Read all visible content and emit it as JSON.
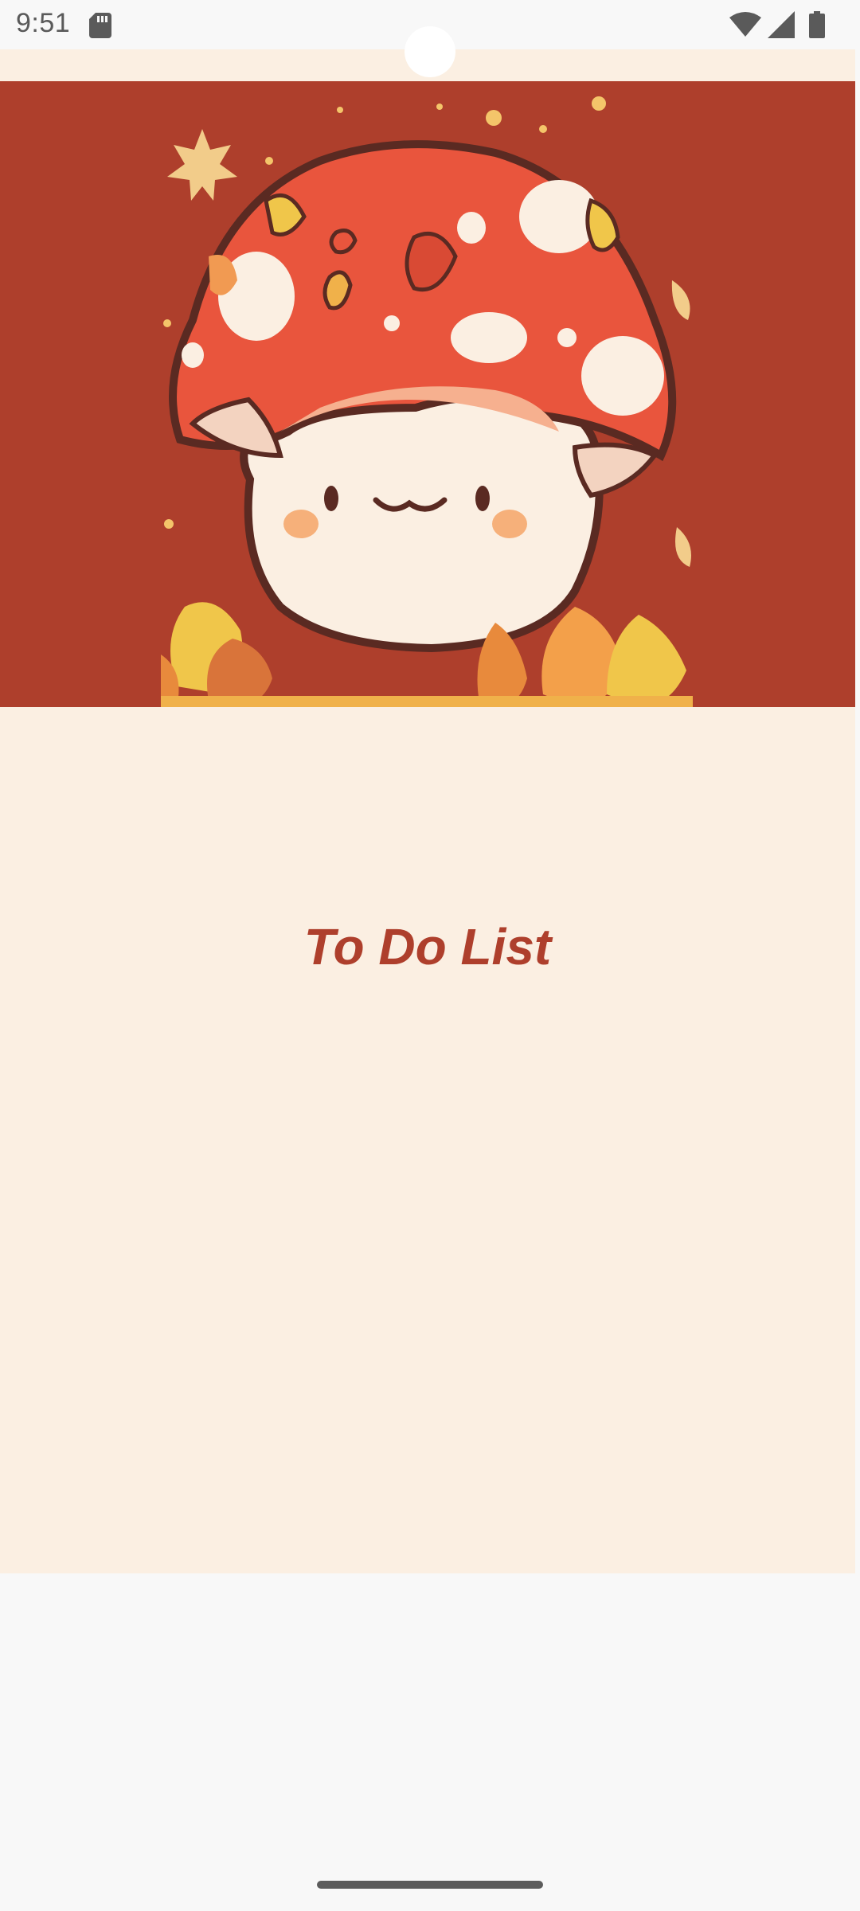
{
  "status_bar": {
    "time": "9:51",
    "icons": [
      "sd-card-icon",
      "wifi-icon",
      "signal-icon",
      "battery-icon"
    ]
  },
  "banner": {
    "image": "mushroom-character-illustration",
    "background_color": "#ae3f2c"
  },
  "main": {
    "title": "To Do List",
    "title_color": "#ae3f2c",
    "background_color": "#fbefe2"
  }
}
